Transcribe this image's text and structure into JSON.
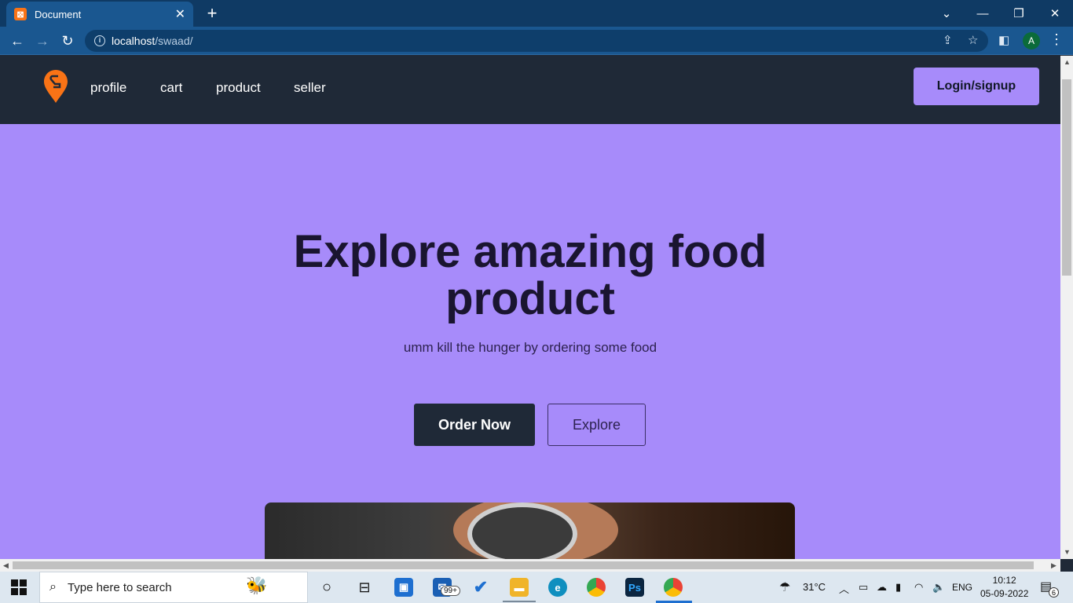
{
  "browser": {
    "tab_title": "Document",
    "tab_close": "✕",
    "new_tab": "+",
    "url_host": "localhost",
    "url_path": "/swaad/",
    "profile_initial": "A"
  },
  "navbar": {
    "links": [
      "profile",
      "cart",
      "product",
      "seller"
    ],
    "login_label": "Login/signup"
  },
  "hero": {
    "title": "Explore amazing food product",
    "subtitle": "umm kill the hunger by ordering some food",
    "order_label": "Order Now",
    "explore_label": "Explore"
  },
  "colors": {
    "navbar_bg": "#1f2937",
    "hero_bg": "#a78bfa",
    "accent": "#a78bfa",
    "logo": "#f97316"
  },
  "taskbar": {
    "search_placeholder": "Type here to search",
    "mail_badge": "99+",
    "weather": "31°C",
    "language": "ENG",
    "time": "10:12",
    "date": "05-09-2022",
    "notification_count": "6"
  }
}
